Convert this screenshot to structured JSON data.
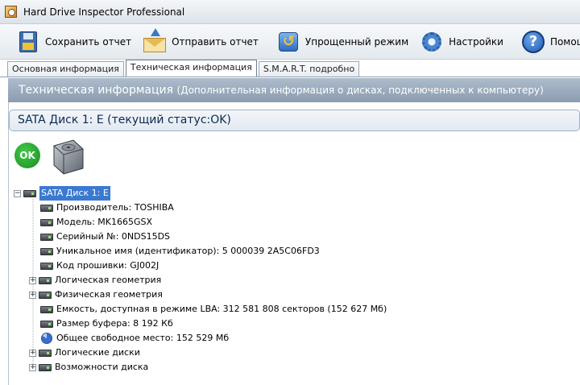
{
  "window": {
    "title": "Hard Drive Inspector Professional"
  },
  "toolbar": {
    "save_label": "Сохранить отчет",
    "send_label": "Отправить отчет",
    "simple_mode_label": "Упрощенный режим",
    "settings_label": "Настройки",
    "help_label": "Помощь"
  },
  "tabs": [
    {
      "label": "Основная информация",
      "active": false
    },
    {
      "label": "Техническая информация",
      "active": true
    },
    {
      "label": "S.M.A.R.T. подробно",
      "active": false
    }
  ],
  "header": {
    "title": "Техническая информация",
    "subtitle": "(Дополнительная информация о дисках, подключенных к компьютеру)"
  },
  "disk": {
    "title": "SATA Диск 1: E (текущий статус:OK)",
    "status_badge": "OK"
  },
  "tree": {
    "root_label": "SATA Диск 1: E",
    "items": [
      {
        "label": "Производитель: TOSHIBA",
        "expandable": false,
        "icon": "drive-icon"
      },
      {
        "label": "Модель: MK1665GSX",
        "expandable": false,
        "icon": "drive-icon"
      },
      {
        "label": "Серийный №: 0NDS15DS",
        "expandable": false,
        "icon": "drive-icon"
      },
      {
        "label": "Уникальное имя (идентификатор): 5 000039 2A5C06FD3",
        "expandable": false,
        "icon": "drive-icon"
      },
      {
        "label": "Код прошивки: GJ002J",
        "expandable": false,
        "icon": "drive-icon"
      },
      {
        "label": "Логическая геометрия",
        "expandable": true,
        "icon": "drive-icon"
      },
      {
        "label": "Физическая геометрия",
        "expandable": true,
        "icon": "drive-icon"
      },
      {
        "label": "Емкость, доступная в режиме LBA: 312 581 808 секторов (152 627 Мб)",
        "expandable": false,
        "icon": "drive-icon"
      },
      {
        "label": "Размер буфера: 8 192 Кб",
        "expandable": false,
        "icon": "drive-icon"
      },
      {
        "label": "Общее свободное место: 152 529 Мб",
        "expandable": false,
        "icon": "pie-chart-icon"
      },
      {
        "label": "Логические диски",
        "expandable": true,
        "icon": "drive-icon"
      },
      {
        "label": "Возможности диска",
        "expandable": true,
        "icon": "drive-icon"
      }
    ]
  },
  "colors": {
    "header_band": "#9aabbd",
    "selection": "#3b79d1",
    "ok_green": "#23a02b"
  }
}
